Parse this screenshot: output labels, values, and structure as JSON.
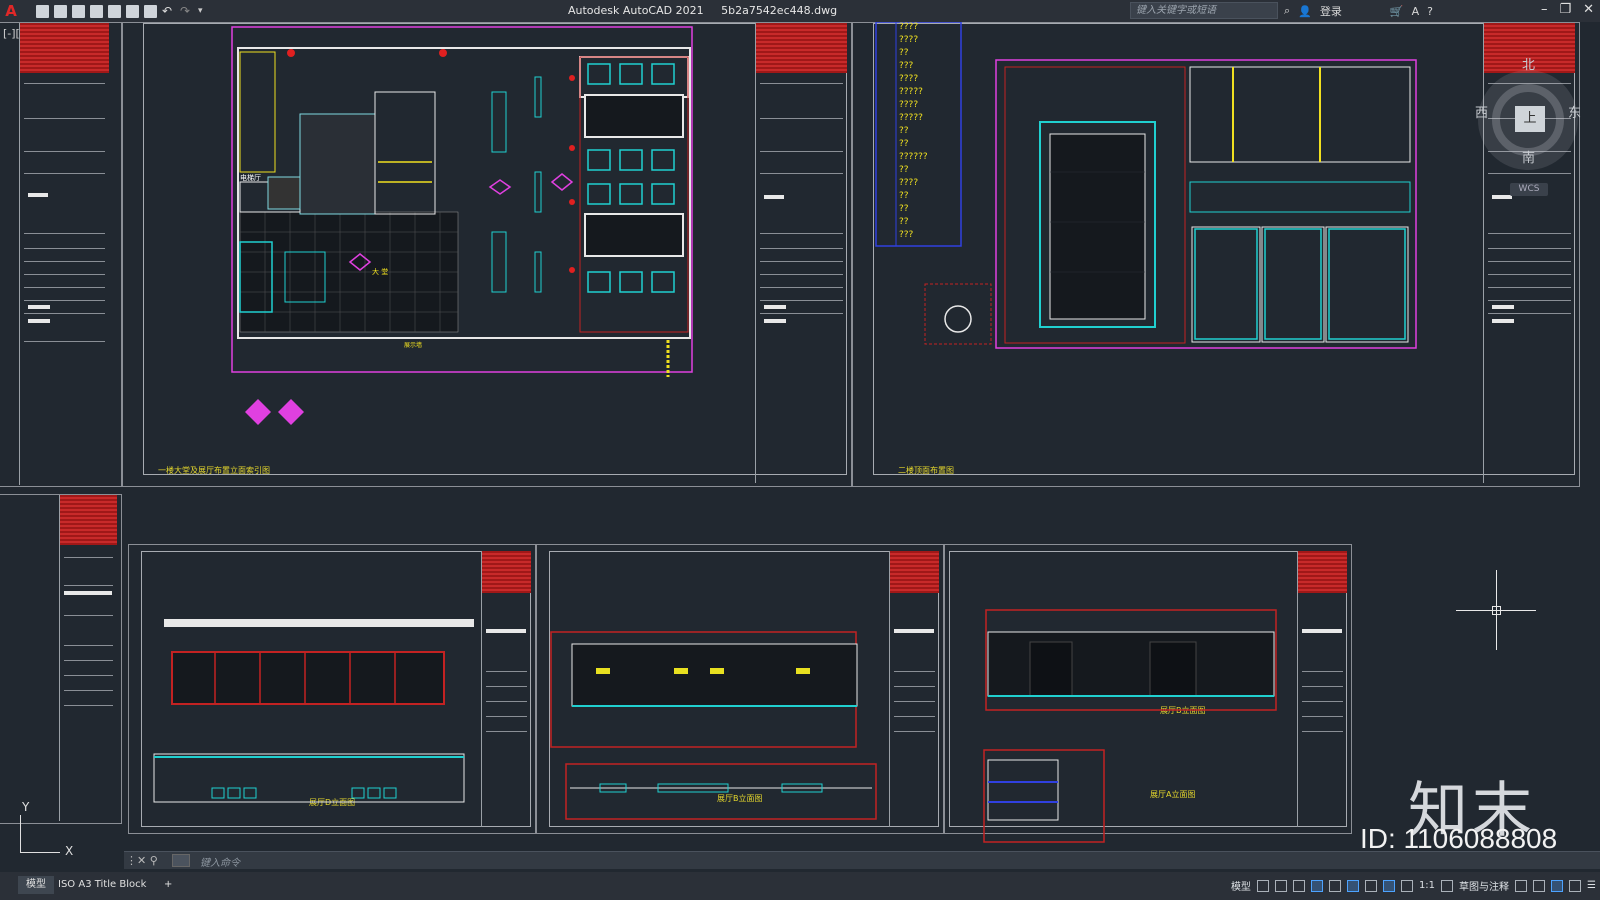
{
  "app": {
    "name": "Autodesk AutoCAD 2021",
    "file": "5b2a7542ec448.dwg"
  },
  "search": {
    "placeholder": "键入关键字或短语"
  },
  "account": {
    "login_label": "登录"
  },
  "viewport": {
    "view_label": "[-][俯视][二维线框]",
    "compass": {
      "north": "北",
      "south": "南",
      "east": "东",
      "west": "西",
      "face": "上",
      "wcs": "WCS"
    },
    "ucs": {
      "y": "Y",
      "x": "X"
    }
  },
  "sheets": {
    "plan1_caption": "一楼大堂及展厅布置立面索引图",
    "plan2_caption": "二楼顶面布置图",
    "elev_d_caption": "展厅D立面图",
    "elev_b1_caption": "展厅B立面图",
    "elev_b2_caption": "展厅B立面图",
    "elev_a_caption": "展厅A立面图",
    "plan1_labels": [
      "电梯厅",
      "大 堂",
      "展示墙"
    ],
    "legend_items": [
      "????",
      "????",
      "??",
      "???",
      "????",
      "?????",
      "????",
      "?????",
      "??",
      "??",
      "??????",
      "??",
      "????",
      "??",
      "??",
      "??",
      "???"
    ]
  },
  "command": {
    "placeholder": "键入命令"
  },
  "status": {
    "tabs": [
      "模型",
      "ISO A3 Title Block",
      "+"
    ],
    "model_label": "模型",
    "scale": "1:1",
    "annotate": "草图与注释"
  },
  "watermark": {
    "brand": "知末",
    "id": "ID: 1106088808"
  },
  "colors": {
    "background": "#212830",
    "accent_red": "#c32222",
    "magenta": "#e040e0",
    "yellow": "#f0e020",
    "cyan": "#20d0d0"
  }
}
